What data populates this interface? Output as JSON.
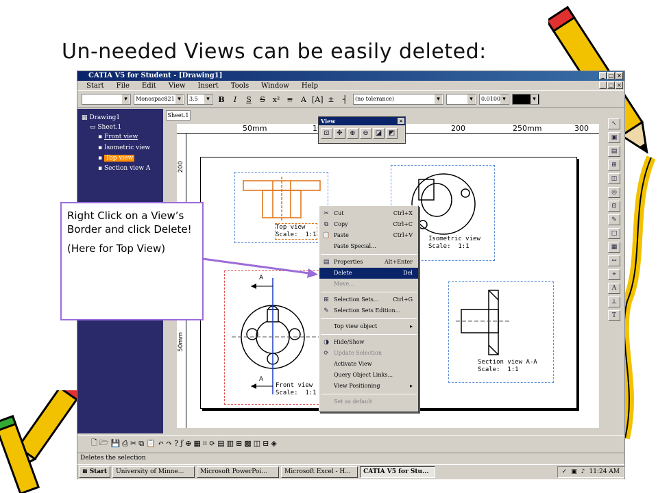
{
  "slide": {
    "title": "Un-needed Views can be easily deleted:"
  },
  "window": {
    "title": "CATIA V5 for Student - [Drawing1]",
    "menu": [
      "Start",
      "File",
      "Edit",
      "View",
      "Insert",
      "Tools",
      "Window",
      "Help"
    ]
  },
  "toolbar": {
    "font_name": "Monospac821 B",
    "font_size": "3.5",
    "tolerance": "(no tolerance)",
    "precision": "0.0100"
  },
  "tree": {
    "root": "Drawing1",
    "sheet": "Sheet.1",
    "views": [
      "Front view",
      "Isometric view",
      "Top view",
      "Section view A"
    ],
    "selected_index": 2
  },
  "canvas": {
    "sheet_tab": "Sheet.1",
    "ruler_top": [
      "50mm",
      "100",
      "200",
      "250mm",
      "300"
    ],
    "ruler_left": [
      "200",
      "50mm"
    ],
    "views": {
      "top": {
        "name": "Top view",
        "scale": "Scale:  1:1"
      },
      "isometric": {
        "name": "Isometric view",
        "scale": "Scale:  1:1"
      },
      "front": {
        "name": "Front view",
        "scale": "Scale:  1:1"
      },
      "section": {
        "name": "Section view A-A",
        "scale": "Scale:  1:1"
      }
    },
    "section_marker": "A"
  },
  "view_toolbar": {
    "title": "View"
  },
  "context_menu": {
    "items": [
      {
        "label": "Cut",
        "shortcut": "Ctrl+X",
        "icon": "scissors-icon"
      },
      {
        "label": "Copy",
        "shortcut": "Ctrl+C",
        "icon": "copy-icon"
      },
      {
        "label": "Paste",
        "shortcut": "Ctrl+V",
        "icon": "paste-icon"
      },
      {
        "label": "Paste Special...",
        "shortcut": "",
        "icon": ""
      },
      {
        "label": "Properties",
        "shortcut": "Alt+Enter",
        "icon": "properties-icon"
      },
      {
        "label": "Delete",
        "shortcut": "Del",
        "icon": ""
      },
      {
        "label": "Move...",
        "shortcut": "",
        "icon": ""
      },
      {
        "label": "Selection Sets...",
        "shortcut": "Ctrl+G",
        "icon": "selection-sets-icon"
      },
      {
        "label": "Selection Sets Edition...",
        "shortcut": "",
        "icon": "selection-edit-icon"
      },
      {
        "label": "Top view object",
        "shortcut": "",
        "icon": ""
      },
      {
        "label": "Hide/Show",
        "shortcut": "",
        "icon": "hide-show-icon"
      },
      {
        "label": "Update Selection",
        "shortcut": "",
        "icon": "update-icon"
      },
      {
        "label": "Activate View",
        "shortcut": "",
        "icon": ""
      },
      {
        "label": "Query Object Links...",
        "shortcut": "",
        "icon": ""
      },
      {
        "label": "View Positioning",
        "shortcut": "",
        "icon": ""
      },
      {
        "label": "Set as default",
        "shortcut": "",
        "icon": ""
      }
    ]
  },
  "callout": {
    "line1": "Right Click on a View’s Border and click Delete!",
    "line2": "(Here for Top View)"
  },
  "statusbar": {
    "text": "Deletes the selection"
  },
  "taskbar": {
    "start": "Start",
    "tasks": [
      "University of Minne...",
      "Microsoft PowerPoi...",
      "Microsoft Excel - H...",
      "CATIA V5 for Stu..."
    ],
    "clock": "11:24 AM"
  },
  "colors": {
    "tree_bg": "#2a2a6a",
    "highlight": "#0a246a",
    "callout_border": "#9b6cd9",
    "view_frame": "#5b8fd9",
    "selected_view": "#ff8c00"
  }
}
